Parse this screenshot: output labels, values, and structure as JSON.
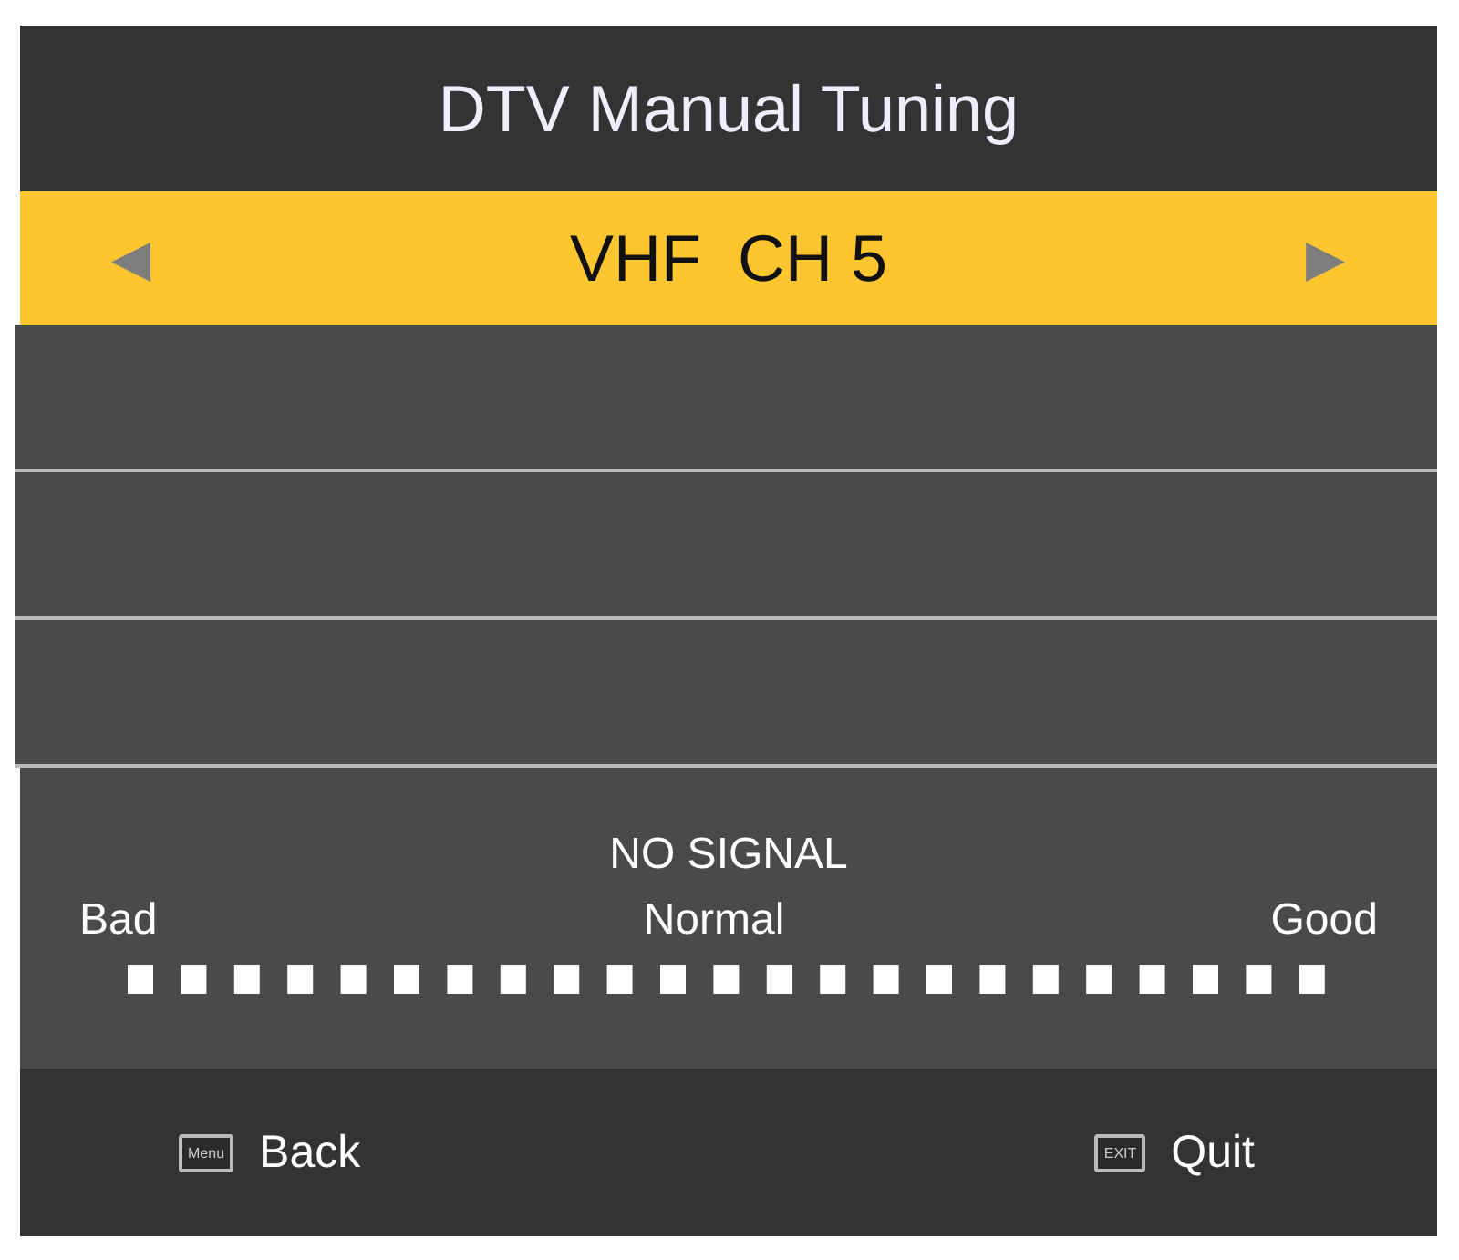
{
  "title": "DTV Manual Tuning",
  "channel_selector": {
    "left_arrow": "◀",
    "value": "VHF  CH 5",
    "right_arrow": "▶"
  },
  "signal": {
    "status": "NO SIGNAL",
    "scale_labels": [
      "Bad",
      "Normal",
      "Good"
    ]
  },
  "footer": [
    {
      "key": "Menu",
      "label": "Back"
    },
    {
      "key": "EXIT",
      "label": "Quit"
    }
  ]
}
